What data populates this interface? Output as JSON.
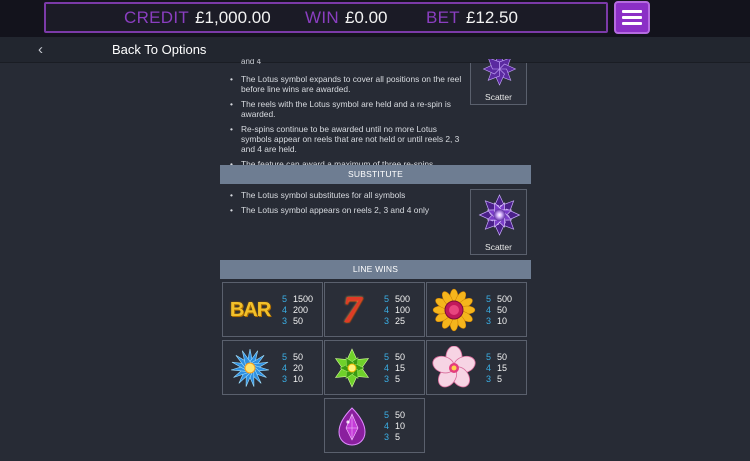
{
  "header": {
    "credit_label": "CREDIT",
    "credit_value": "£1,000.00",
    "win_label": "WIN",
    "win_value": "£0.00",
    "bet_label": "BET",
    "bet_value": "£12.50",
    "menu_icon": "hamburger-icon"
  },
  "nav": {
    "back_icon": "chevron-left-icon",
    "back_label": "Back To Options"
  },
  "respin_section": {
    "cut_text": "and 4",
    "rules": [
      "The Lotus symbol expands to cover all positions on the reel before line wins are awarded.",
      "The reels with the Lotus symbol are held and a re-spin is awarded.",
      "Re-spins continue to be awarded until no more Lotus symbols appear on reels that are not held or until reels 2, 3 and 4 are held.",
      "The feature can award a maximum of three re-spins."
    ],
    "scatter_label": "Scatter"
  },
  "substitute_section": {
    "title": "SUBSTITUTE",
    "rules": [
      "The Lotus symbol substitutes for all symbols",
      "The Lotus symbol appears on reels 2, 3 and 4 only"
    ],
    "scatter_label": "Scatter"
  },
  "line_wins": {
    "title": "LINE WINS",
    "symbols": [
      {
        "icon": "bar-symbol",
        "label": "BAR",
        "pays": [
          {
            "n": "5",
            "v": "1500"
          },
          {
            "n": "4",
            "v": "200"
          },
          {
            "n": "3",
            "v": "50"
          }
        ]
      },
      {
        "icon": "seven-symbol",
        "label": "7",
        "pays": [
          {
            "n": "5",
            "v": "500"
          },
          {
            "n": "4",
            "v": "100"
          },
          {
            "n": "3",
            "v": "25"
          }
        ]
      },
      {
        "icon": "sunflower-symbol",
        "pays": [
          {
            "n": "5",
            "v": "500"
          },
          {
            "n": "4",
            "v": "50"
          },
          {
            "n": "3",
            "v": "10"
          }
        ]
      },
      {
        "icon": "blue-flower-symbol",
        "pays": [
          {
            "n": "5",
            "v": "50"
          },
          {
            "n": "4",
            "v": "20"
          },
          {
            "n": "3",
            "v": "10"
          }
        ]
      },
      {
        "icon": "green-flower-symbol",
        "pays": [
          {
            "n": "5",
            "v": "50"
          },
          {
            "n": "4",
            "v": "15"
          },
          {
            "n": "3",
            "v": "5"
          }
        ]
      },
      {
        "icon": "pink-flower-symbol",
        "pays": [
          {
            "n": "5",
            "v": "50"
          },
          {
            "n": "4",
            "v": "15"
          },
          {
            "n": "3",
            "v": "5"
          }
        ]
      },
      {
        "icon": "purple-gem-symbol",
        "pays": [
          {
            "n": "5",
            "v": "50"
          },
          {
            "n": "4",
            "v": "10"
          },
          {
            "n": "3",
            "v": "5"
          }
        ]
      }
    ]
  },
  "colors": {
    "accent": "#8b2fc6",
    "label_purple": "#8a3ec0",
    "section_header": "#6e7d92",
    "count_blue": "#3aaee4",
    "background": "#272b35"
  }
}
